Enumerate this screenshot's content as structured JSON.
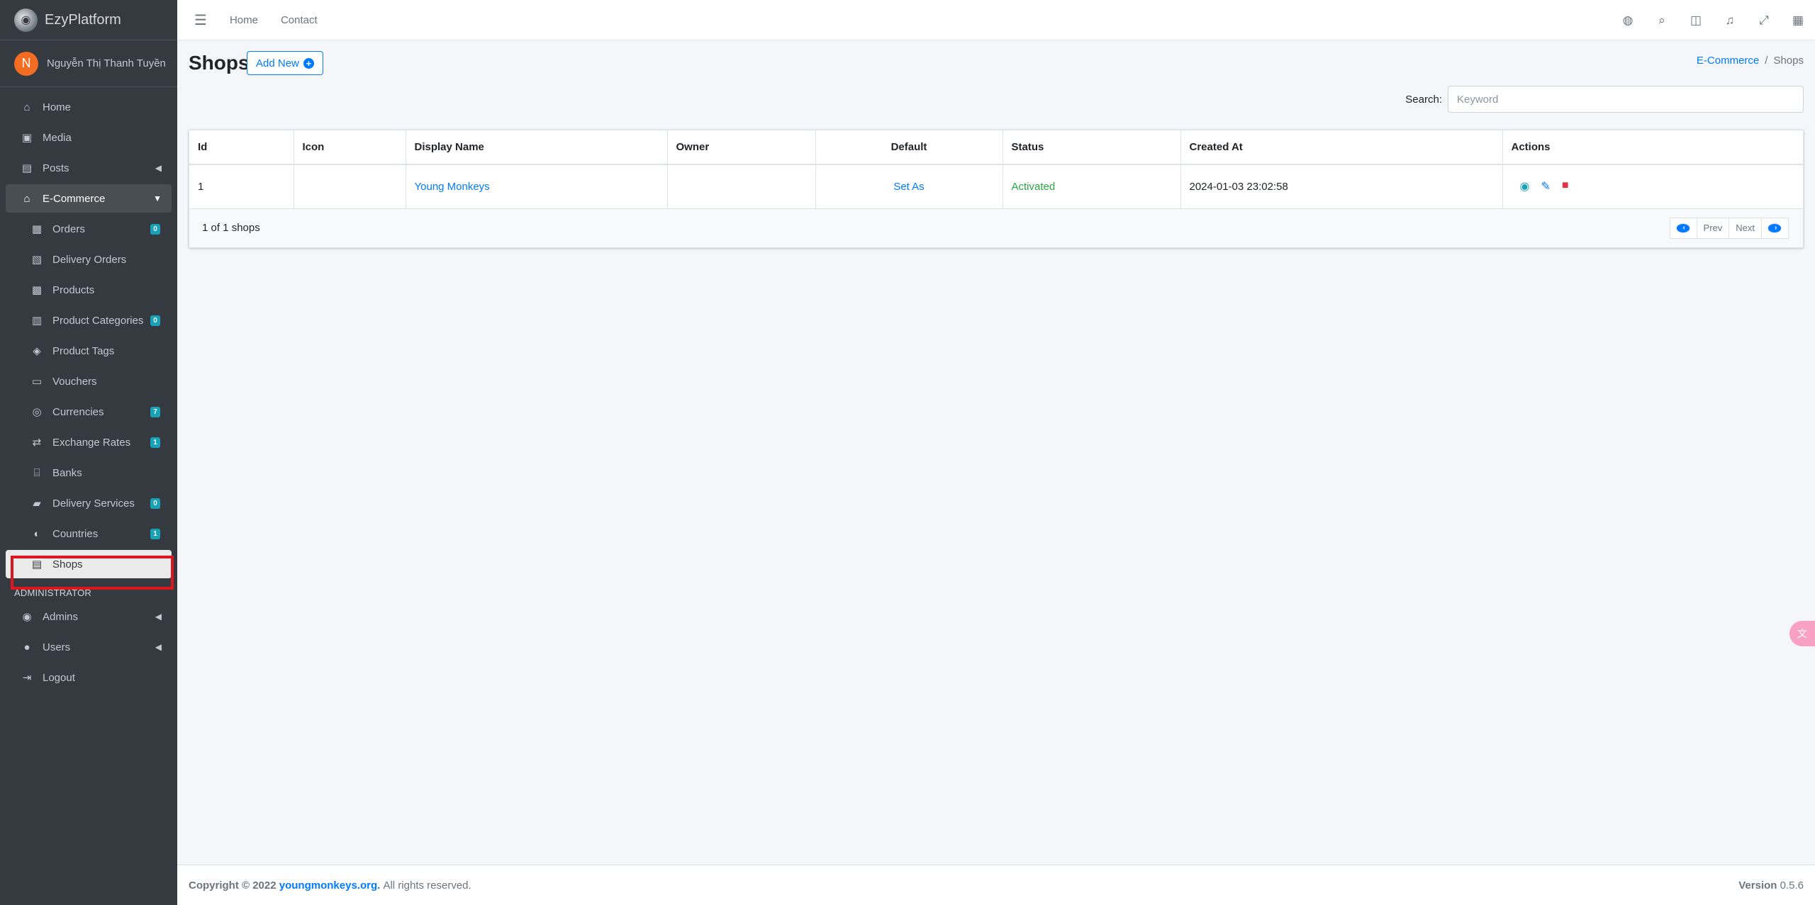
{
  "brand": {
    "name": "EzyPlatform"
  },
  "user": {
    "initial": "N",
    "name": "Nguyễn Thị Thanh Tuyền"
  },
  "sidebar": {
    "items": [
      {
        "label": "Home",
        "icon": "home-icon"
      },
      {
        "label": "Media",
        "icon": "image-icon"
      },
      {
        "label": "Posts",
        "icon": "posts-icon"
      },
      {
        "label": "E-Commerce",
        "icon": "basket-icon"
      }
    ],
    "ecommerce": [
      {
        "label": "Orders",
        "badge": "0"
      },
      {
        "label": "Delivery Orders",
        "badge": ""
      },
      {
        "label": "Products",
        "badge": ""
      },
      {
        "label": "Product Categories",
        "badge": "0"
      },
      {
        "label": "Product Tags",
        "badge": ""
      },
      {
        "label": "Vouchers",
        "badge": ""
      },
      {
        "label": "Currencies",
        "badge": "7"
      },
      {
        "label": "Exchange Rates",
        "badge": "1"
      },
      {
        "label": "Banks",
        "badge": ""
      },
      {
        "label": "Delivery Services",
        "badge": "0"
      },
      {
        "label": "Countries",
        "badge": "1"
      },
      {
        "label": "Shops",
        "badge": ""
      }
    ],
    "admin_header": "ADMINISTRATOR",
    "admin_items": [
      {
        "label": "Admins"
      },
      {
        "label": "Users"
      },
      {
        "label": "Logout"
      }
    ]
  },
  "topbar": {
    "links": [
      "Home",
      "Contact"
    ]
  },
  "page": {
    "title": "Shops",
    "add_label": "Add New",
    "breadcrumb": {
      "parent": "E-Commerce",
      "current": "Shops"
    },
    "search_label": "Search:",
    "search_placeholder": "Keyword"
  },
  "table": {
    "headers": [
      "Id",
      "Icon",
      "Display Name",
      "Owner",
      "Default",
      "Status",
      "Created At",
      "Actions"
    ],
    "rows": [
      {
        "id": "1",
        "icon": "",
        "display_name": "Young Monkeys",
        "owner": "",
        "default": "Set As",
        "status": "Activated",
        "created_at": "2024-01-03 23:02:58"
      }
    ],
    "summary": "1 of 1 shops",
    "pager": {
      "prev": "Prev",
      "next": "Next"
    }
  },
  "footer": {
    "copyright": "Copyright © 2022",
    "site": "youngmonkeys.org.",
    "rights": "All rights reserved.",
    "version_label": "Version",
    "version": "0.5.6"
  },
  "colors": {
    "primary": "#007bff",
    "sidebar": "#343a40",
    "success": "#28a745",
    "danger": "#dc3545",
    "info": "#17a2b8",
    "highlight": "#e0161e"
  }
}
